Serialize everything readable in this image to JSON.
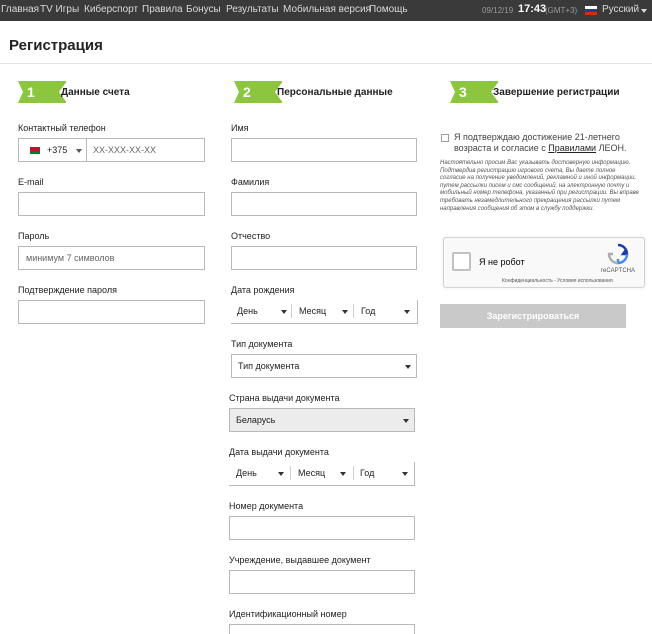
{
  "topbar": {
    "nav": [
      "Главная",
      "TV Игры",
      "Киберспорт",
      "Правила",
      "Бонусы",
      "Результаты",
      "Мобильная версия",
      "Помощь"
    ],
    "date": "09/12/19",
    "time": "17:43",
    "gmt": "(GMT+3)",
    "language": "Русский"
  },
  "page": {
    "title": "Регистрация"
  },
  "steps": [
    {
      "num": "1",
      "label": "Данные счета"
    },
    {
      "num": "2",
      "label": "Персональные данные"
    },
    {
      "num": "3",
      "label": "Завершение регистрации"
    }
  ],
  "account": {
    "phone_label": "Контактный телефон",
    "phone_code": "+375",
    "phone_placeholder": "XX-XXX-XX-XX",
    "email_label": "E-mail",
    "password_label": "Пароль",
    "password_placeholder": "минимум 7 символов",
    "password_confirm_label": "Подтверждение пароля"
  },
  "personal": {
    "name_label": "Имя",
    "surname_label": "Фамилия",
    "patronymic_label": "Отчество",
    "birthdate_label": "Дата рождения",
    "day": "День",
    "month": "Месяц",
    "year": "Год",
    "doctype_label": "Тип документа",
    "doctype_value": "Тип документа",
    "country_label": "Страна выдачи документа",
    "country_value": "Беларусь",
    "issue_date_label": "Дата выдачи документа",
    "docnum_label": "Номер документа",
    "issuer_label": "Учреждение, выдавшее документ",
    "idnum_label": "Идентификационный номер"
  },
  "finish": {
    "agree_text": "Я подтверждаю достижение 21-летнего возраста и согласие с",
    "agree_link": "Правилами",
    "agree_suffix": "ЛЕОН.",
    "fine_print": "Настоятельно просим Вас указывать достоверную информацию. Подтвердив регистрацию игрового счета, Вы даете полное согласие на получение уведомлений, рекламной и иной информации, путем рассылки писем и смс сообщений, на электронную почту и мобильный номер телефона, указанный при регистрации. Вы вправе требовать незамедлительного прекращения рассылки путем направления сообщения об этом в службу поддержки.",
    "captcha_label": "Я не робот",
    "captcha_brand": "reCAPTCHA",
    "captcha_links": "Конфиденциальность - Условия использования",
    "register_button": "Зарегистрироваться"
  }
}
